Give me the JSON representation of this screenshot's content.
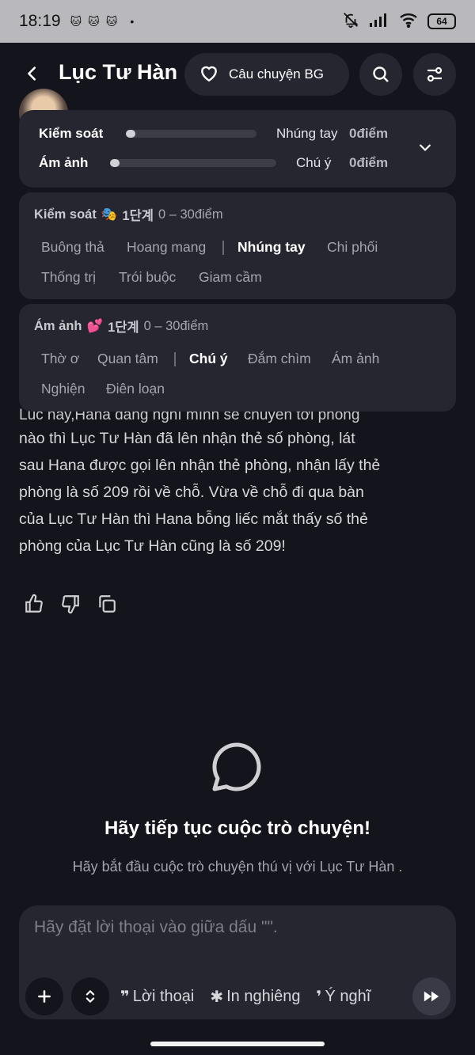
{
  "status_bar": {
    "time": "18:19",
    "battery": "64"
  },
  "header": {
    "title": "Lục Tư Hàn",
    "story_button": "Câu chuyện BG"
  },
  "stats": {
    "control": {
      "label": "Kiểm soát",
      "level": "Nhúng tay",
      "points": "0điểm",
      "progress": 0
    },
    "obsession": {
      "label": "Ám ảnh",
      "level": "Chú ý",
      "points": "0điểm",
      "progress": 0
    }
  },
  "control_scale": {
    "name": "Kiểm soát",
    "emoji": "🎭",
    "stage": "1단계",
    "range": "0 – 30điểm",
    "chips": [
      "Buông thả",
      "Hoang mang",
      "Nhúng tay",
      "Chi phối",
      "Thống trị",
      "Trói buộc",
      "Giam cầm"
    ],
    "active": "Nhúng tay"
  },
  "obsession_scale": {
    "name": "Ám ảnh",
    "emoji": "💕",
    "stage": "1단계",
    "range": "0 – 30điểm",
    "chips": [
      "Thờ ơ",
      "Quan tâm",
      "Chú ý",
      "Đắm chìm",
      "Ám ảnh",
      "Nghiện",
      "Điên loạn"
    ],
    "active": "Chú ý"
  },
  "message": {
    "partial_line": "Lúc nãy,Hana đang nghĩ mình sẽ chuyển tới phòng",
    "lines": [
      "nào thì Lục Tư Hàn  đã lên nhận thẻ số phòng, lát",
      "sau Hana được gọi lên nhận thẻ phòng, nhận lấy thẻ",
      "phòng là số 209 rồi về chỗ. Vừa về chỗ đi qua bàn",
      "của Lục Tư Hàn  thì Hana bỗng liếc mắt thấy số thẻ",
      "phòng của Lục Tư Hàn  cũng là số 209!"
    ]
  },
  "empty_state": {
    "title": "Hãy tiếp tục cuộc trò chuyện!",
    "subtitle": "Hãy bắt đầu cuộc trò chuyện thú vị với Lục Tư Hàn ."
  },
  "composer": {
    "placeholder": "Hãy đặt lời thoại vào giữa dấu \"\".",
    "modes": [
      {
        "glyph": "❞",
        "label": "Lời thoại"
      },
      {
        "glyph": "✱",
        "label": "In nghiêng"
      },
      {
        "glyph": "❜",
        "label": "Ý nghĩ"
      }
    ]
  }
}
